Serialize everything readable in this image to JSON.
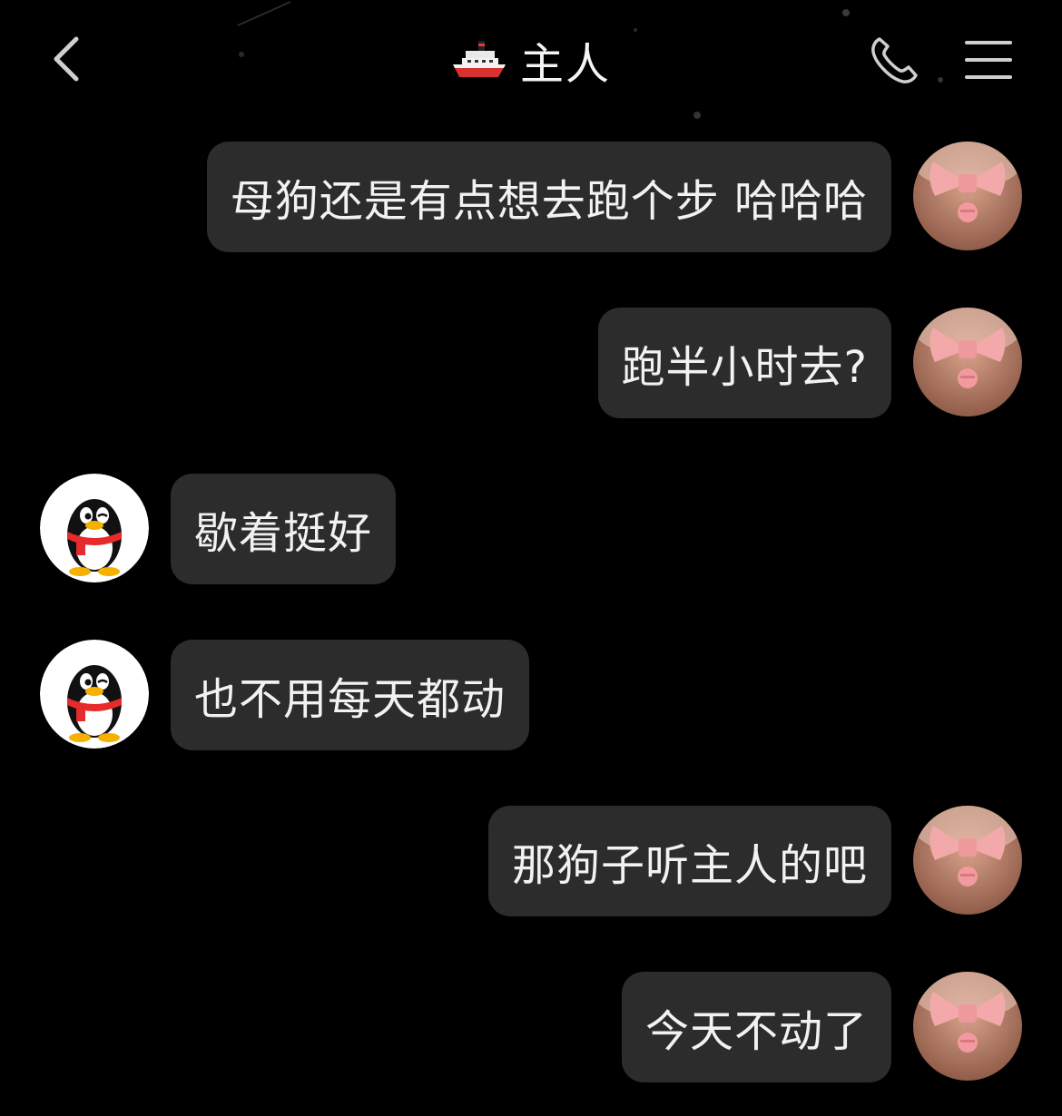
{
  "header": {
    "title": "主人",
    "title_emoji": "ship-icon"
  },
  "messages": [
    {
      "side": "out",
      "text": "母狗还是有点想去跑个步 哈哈哈"
    },
    {
      "side": "out",
      "text": "跑半小时去?"
    },
    {
      "side": "in",
      "text": "歇着挺好"
    },
    {
      "side": "in",
      "text": "也不用每天都动"
    },
    {
      "side": "out",
      "text": "那狗子听主人的吧"
    },
    {
      "side": "out",
      "text": "今天不动了"
    }
  ],
  "colors": {
    "background": "#000000",
    "bubble": "#2c2c2c",
    "text": "#f2f2f2"
  }
}
